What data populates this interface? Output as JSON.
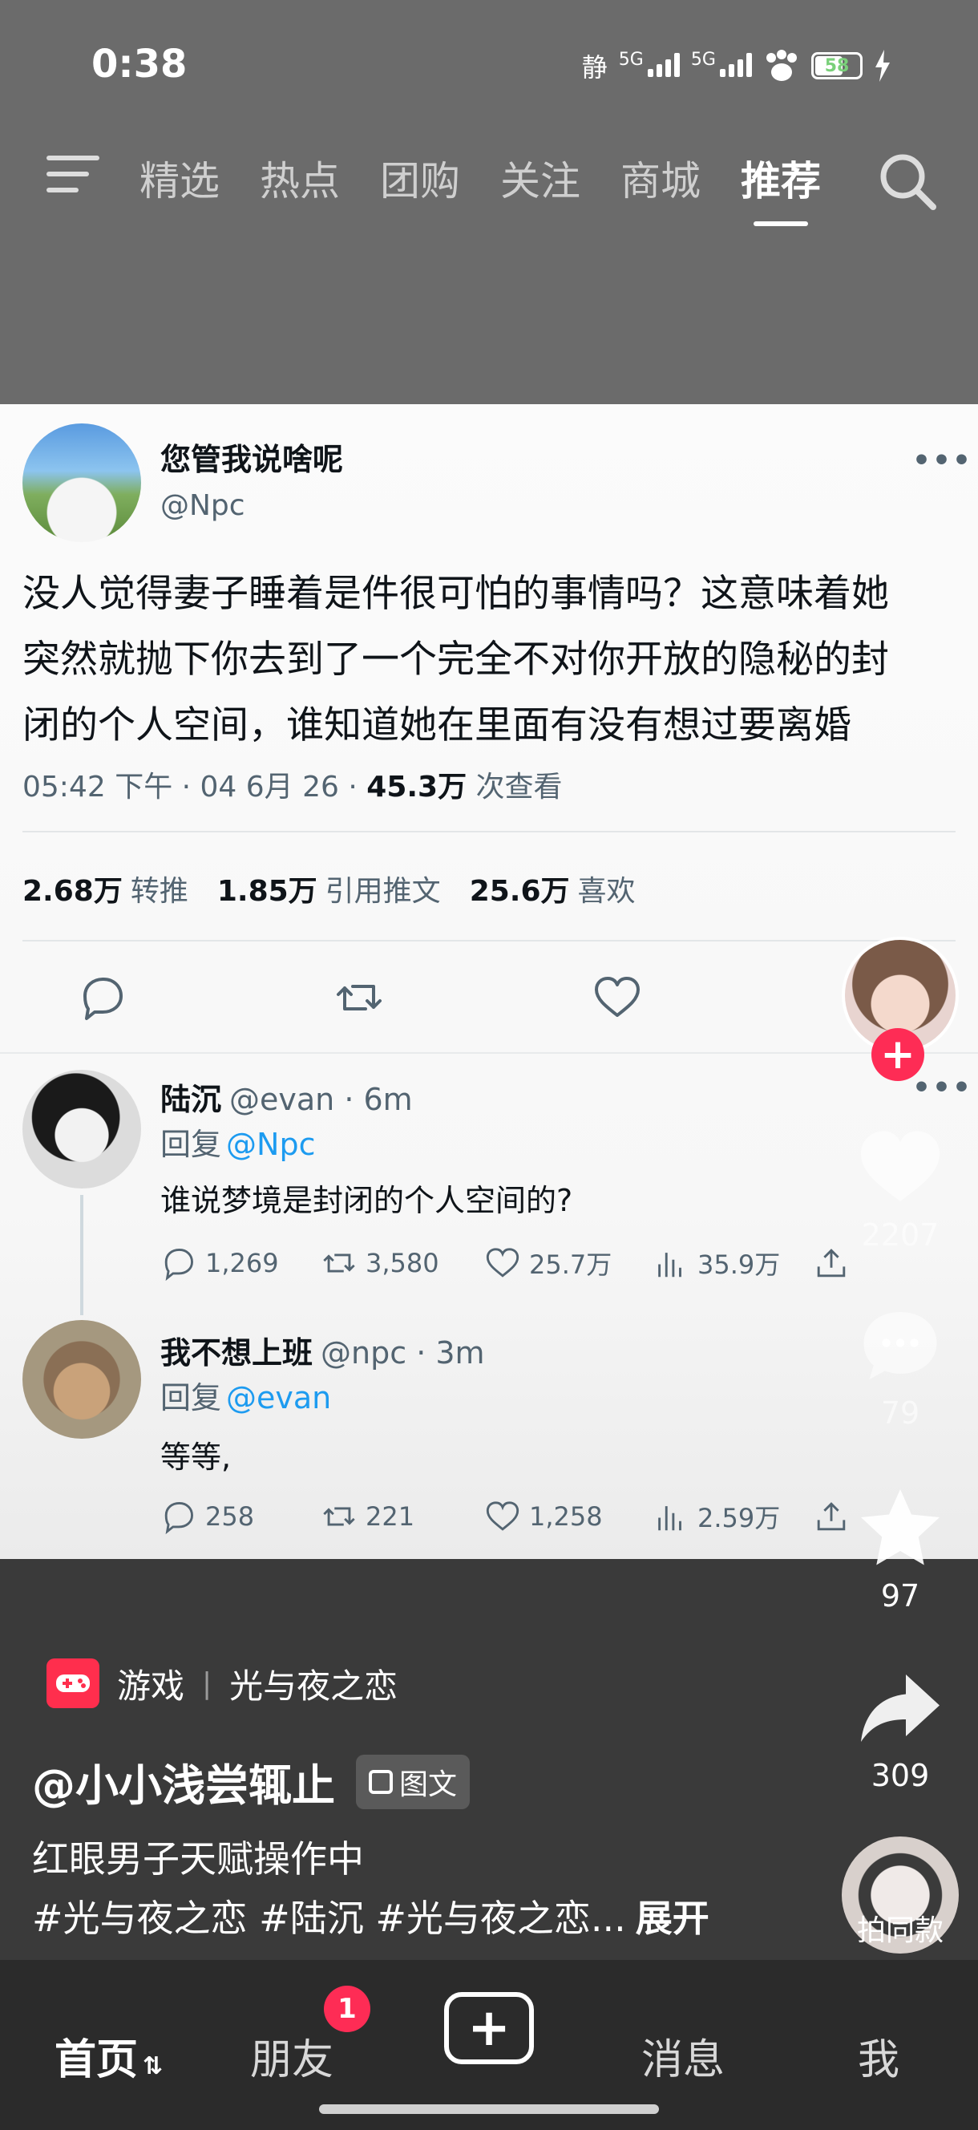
{
  "status_bar": {
    "time": "0:38",
    "mode": "静",
    "network_1": "5G",
    "network_2": "5G",
    "battery": "58"
  },
  "top_nav": {
    "tabs": [
      "精选",
      "热点",
      "团购",
      "关注",
      "商城",
      "推荐"
    ],
    "active_tab": "推荐"
  },
  "tweet": {
    "author_name": "您管我说啥呢",
    "author_handle": "@Npc",
    "text_lines": [
      "没人觉得妻子睡着是件很可怕的事情吗？这意味着她",
      "突然就抛下你去到了一个完全不对你开放的隐秘的封",
      "闭的个人空间，谁知道她在里面有没有想过要离婚"
    ],
    "timestamp": "05:42 下午 · 04 6月 26 · ",
    "views_value": "45.3万",
    "views_label": " 次查看",
    "retweets_value": "2.68万",
    "retweets_label": "转推",
    "quotes_value": "1.85万",
    "quotes_label": "引用推文",
    "likes_value": "25.6万",
    "likes_label": "喜欢",
    "more": "•••"
  },
  "replies": [
    {
      "name": "陆沉",
      "handle_time": "@evan · 6m",
      "reply_prefix": "回复",
      "reply_to": "@Npc",
      "text": "谁说梦境是封闭的个人空间的?",
      "comments": "1,269",
      "retweets": "3,580",
      "likes": "25.7万",
      "views": "35.9万"
    },
    {
      "name": "我不想上班",
      "handle_time": "@npc · 3m",
      "reply_prefix": "回复",
      "reply_to": "@evan",
      "text": "等等,",
      "comments": "258",
      "retweets": "221",
      "likes": "1,258",
      "views": "2.59万"
    }
  ],
  "rail": {
    "likes": "2207",
    "comments": "79",
    "favorites": "97",
    "shares": "309",
    "same_style": "拍同款"
  },
  "video_info": {
    "category": "游戏",
    "game": "光与夜之恋",
    "author": "@小小浅尝辄止",
    "content_type": "图文",
    "description": "红眼男子天赋操作中",
    "hashtags": "#光与夜之恋 #陆沉 #光与夜之恋...",
    "expand": "展开"
  },
  "tab_bar": {
    "home": "首页",
    "home_swap": "⇅",
    "friends": "朋友",
    "friends_badge": "1",
    "create": "+",
    "messages": "消息",
    "me": "我"
  }
}
